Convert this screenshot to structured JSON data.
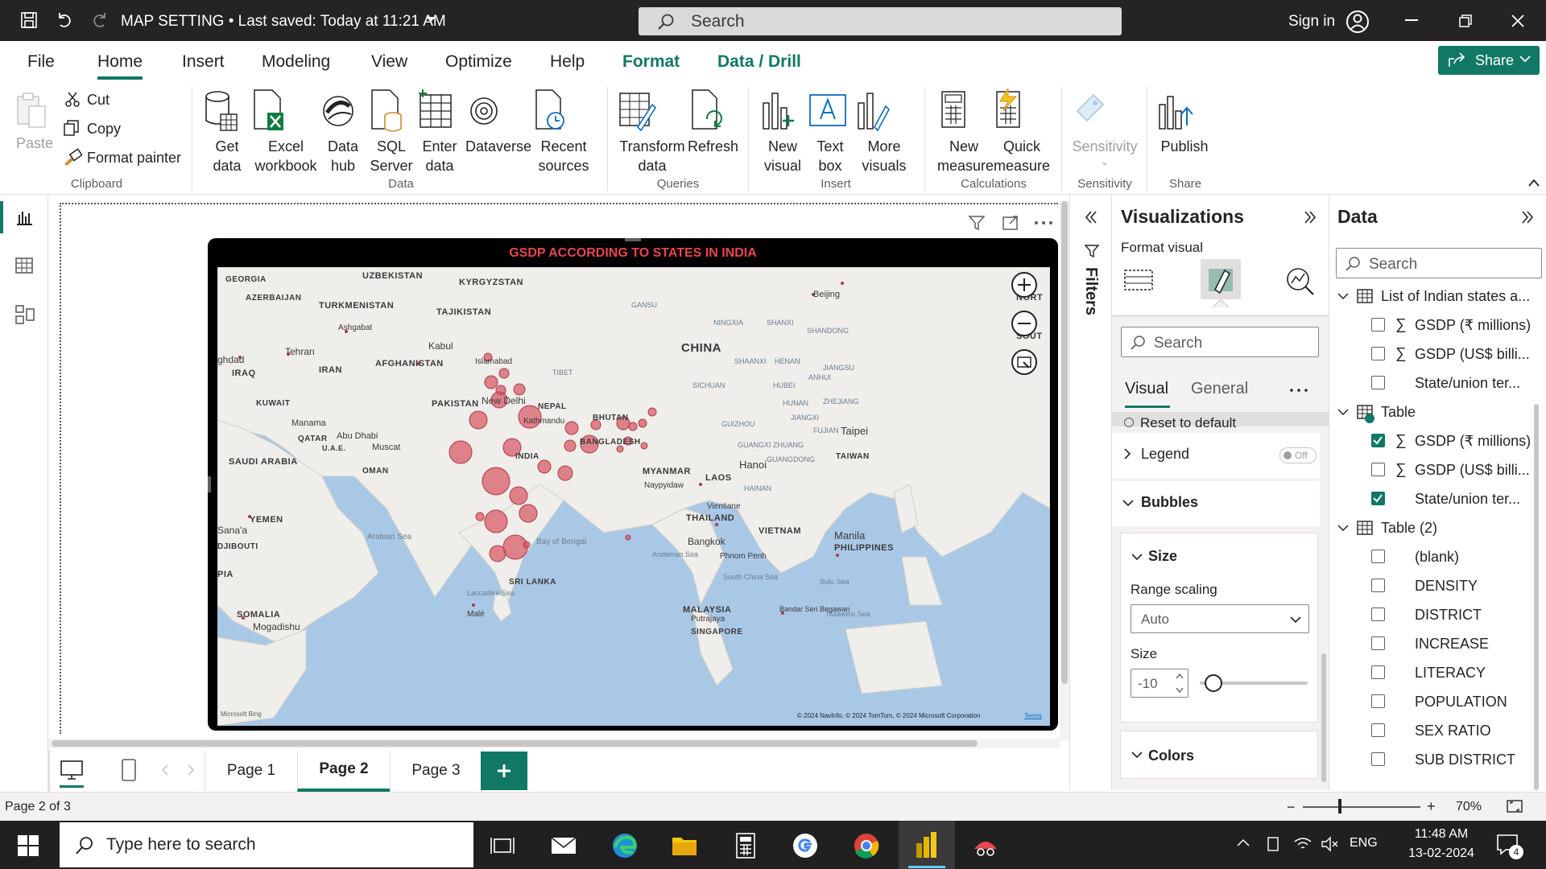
{
  "titlebar": {
    "title": "MAP SETTING • Last saved: Today at 11:21 AM",
    "search_placeholder": "Search",
    "sign_in": "Sign in"
  },
  "menu": {
    "tabs": [
      "File",
      "Home",
      "Insert",
      "Modeling",
      "View",
      "Optimize",
      "Help",
      "Format",
      "Data / Drill"
    ],
    "active": "Home",
    "share": "Share"
  },
  "ribbon": {
    "clipboard": {
      "paste": "Paste",
      "cut": "Cut",
      "copy": "Copy",
      "format_painter": "Format painter",
      "group": "Clipboard"
    },
    "data": {
      "get_data": "Get data",
      "excel": "Excel workbook",
      "data_hub": "Data hub",
      "sql": "SQL Server",
      "enter_data": "Enter data",
      "dataverse": "Dataverse",
      "recent": "Recent sources",
      "group": "Data"
    },
    "queries": {
      "transform": "Transform data",
      "refresh": "Refresh",
      "group": "Queries"
    },
    "insert": {
      "new_visual": "New visual",
      "text_box": "Text box",
      "more_visuals": "More visuals",
      "group": "Insert"
    },
    "calculations": {
      "new_measure": "New measure",
      "quick_measure": "Quick measure",
      "group": "Calculations"
    },
    "sensitivity": {
      "label": "Sensitivity",
      "group": "Sensitivity"
    },
    "share": {
      "publish": "Publish",
      "group": "Share"
    }
  },
  "map": {
    "title": "GSDP ACCORDING TO STATES IN INDIA",
    "labels": {
      "georgia": "GEORGIA",
      "uzbekistan": "UZBEKISTAN",
      "kyrgyzstan": "KYRGYZSTAN",
      "azerbaijan": "AZERBAIJAN",
      "turkmenistan": "TURKMENISTAN",
      "tajikistan": "TAJIKISTAN",
      "ashgabat": "Ashgabat",
      "kabul": "Kabul",
      "tehran": "Tehran",
      "baghdad": "ghdad",
      "iraq": "IRAQ",
      "iran": "IRAN",
      "afghanistan": "AFGHANISTAN",
      "islamabad": "Islamabad",
      "pakistan": "PAKISTAN",
      "newdelhi": "New Delhi",
      "nepal": "NEPAL",
      "kathmandu": "Kathmandu",
      "bhutan": "BHUTAN",
      "bangladesh": "BANGLADESH",
      "kuwait": "KUWAIT",
      "manama": "Manama",
      "qatar": "QATAR",
      "abudhabi": "Abu Dhabi",
      "uae": "U.A.E.",
      "muscat": "Muscat",
      "saudi": "SAUDI ARABIA",
      "oman": "OMAN",
      "india": "INDIA",
      "myanmar": "MYANMAR",
      "naypyidaw": "Naypyidaw",
      "laos": "LAOS",
      "hanoi": "Hanoi",
      "vientiane": "Vientiane",
      "thailand": "THAILAND",
      "bangkok": "Bangkok",
      "vietnam": "VIETNAM",
      "phnompenh": "Phnom Penh",
      "yemen": "YEMEN",
      "sanaa": "Sana'a",
      "djibouti": "DJIBOUTI",
      "arabiansea": "Arabian Sea",
      "bayofbengal": "Bay of Bengal",
      "andaman": "Andaman Sea",
      "srilanka": "SRI LANKA",
      "laccadive": "Laccadive Sea",
      "southchina": "South China Sea",
      "manila": "Manila",
      "philippines": "PHILIPPINES",
      "sulu": "Sulu Sea",
      "malaysia": "MALAYSIA",
      "putrajaya": "Putrajaya",
      "singapore": "SINGAPORE",
      "bandar": "Bandar Seri Begawan",
      "sulawesi": "Sulawesi Sea",
      "somalia": "SOMALIA",
      "mogadishu": "Mogadishu",
      "male": "Malé",
      "pia": "PIA",
      "china": "CHINA",
      "beijing": "Beijing",
      "gansu": "GANSU",
      "ningxia": "NINGXIA",
      "shanxi": "SHANXI",
      "shandong": "SHANDONG",
      "shaanxi": "SHAANXI",
      "henan": "HENAN",
      "jiangsu": "JIANGSU",
      "anhui": "ANHUI",
      "tibet": "TIBET",
      "sichuan": "SICHUAN",
      "hubei": "HUBEI",
      "zhejiang": "ZHEJIANG",
      "hunan": "HUNAN",
      "jiangxi": "JIANGXI",
      "guizhou": "GUIZHOU",
      "fujian": "FUJIAN",
      "taipei": "Taipei",
      "taiwan": "TAIWAN",
      "guangxi": "GUANGXI ZHUANG",
      "guangdong": "GUANGDONG",
      "hainan": "HAINAN",
      "nort": "NORT",
      "sout": "SOUT"
    },
    "copyright": "© 2024 NavInfo, © 2024 TomTom, © 2024 Microsoft Corporation",
    "terms": "Terms",
    "bing": "Microsoft Bing"
  },
  "chart_data": {
    "type": "scatter",
    "title": "GSDP ACCORDING TO STATES IN INDIA",
    "x": [],
    "series": []
  },
  "filters_label": "Filters",
  "viz": {
    "title": "Visualizations",
    "format_visual": "Format visual",
    "search": "Search",
    "tab_visual": "Visual",
    "tab_general": "General",
    "reset": "Reset to default",
    "legend": "Legend",
    "legend_toggle": "Off",
    "bubbles": "Bubbles",
    "size": "Size",
    "range_scaling": "Range scaling",
    "range_value": "Auto",
    "size_label": "Size",
    "size_value": "-10",
    "colors": "Colors"
  },
  "datapane": {
    "title": "Data",
    "search": "Search",
    "tables": [
      {
        "name": "List of Indian states a...",
        "fields": [
          {
            "label": "GSDP (₹ millions)",
            "sigma": true,
            "checked": false
          },
          {
            "label": "GSDP (US$ billi...",
            "sigma": true,
            "checked": false
          },
          {
            "label": "State/union ter...",
            "sigma": false,
            "checked": false
          }
        ]
      },
      {
        "name": "Table",
        "fields": [
          {
            "label": "GSDP (₹ millions)",
            "sigma": true,
            "checked": true
          },
          {
            "label": "GSDP (US$ billi...",
            "sigma": true,
            "checked": false
          },
          {
            "label": "State/union ter...",
            "sigma": false,
            "checked": true
          }
        ]
      },
      {
        "name": "Table (2)",
        "fields": [
          {
            "label": "(blank)",
            "sigma": false,
            "checked": false
          },
          {
            "label": "DENSITY",
            "sigma": false,
            "checked": false
          },
          {
            "label": "DISTRICT",
            "sigma": false,
            "checked": false
          },
          {
            "label": "INCREASE",
            "sigma": false,
            "checked": false
          },
          {
            "label": "LITERACY",
            "sigma": false,
            "checked": false
          },
          {
            "label": "POPULATION",
            "sigma": false,
            "checked": false
          },
          {
            "label": "SEX RATIO",
            "sigma": false,
            "checked": false
          },
          {
            "label": "SUB DISTRICT",
            "sigma": false,
            "checked": false
          }
        ]
      }
    ]
  },
  "pages": {
    "tabs": [
      "Page 1",
      "Page 2",
      "Page 3"
    ],
    "active": "Page 2"
  },
  "status": {
    "page": "Page 2 of 3",
    "zoom": "70%"
  },
  "taskbar": {
    "search": "Type here to search",
    "lang": "ENG",
    "time": "11:48 AM",
    "date": "13-02-2024",
    "notif": "4"
  },
  "colors": {
    "accent": "#117865",
    "bubble": "#d9535f",
    "titlebar": "#252423"
  }
}
